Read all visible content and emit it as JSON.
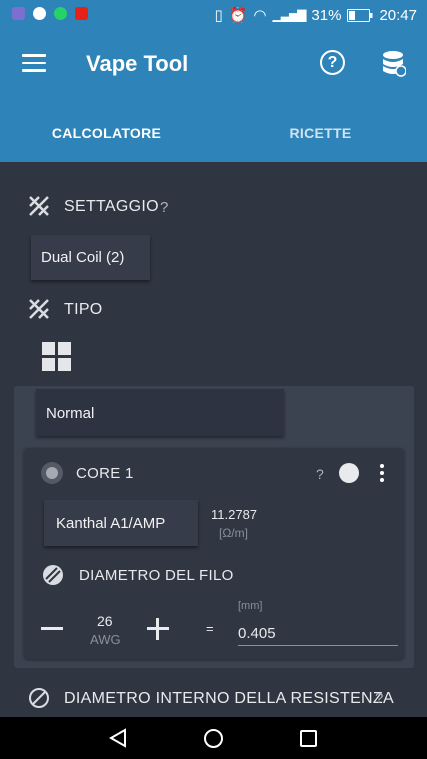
{
  "statusbar": {
    "battery": "31%",
    "time": "20:47"
  },
  "appbar": {
    "title": "Vape Tool",
    "help": "?"
  },
  "tabs": [
    {
      "label": "CALCOLATORE",
      "active": true
    },
    {
      "label": "RICETTE",
      "active": false
    }
  ],
  "settaggio": {
    "label": "SETTAGGIO",
    "help": "?",
    "value": "Dual Coil (2)"
  },
  "tipo": {
    "label": "TIPO",
    "value": "Normal"
  },
  "core": {
    "label": "CORE 1",
    "help": "?",
    "wire": "Kanthal A1/AMP",
    "resistance_per_m": "11.2787",
    "resistance_unit": "[Ω/m]"
  },
  "diametro_filo": {
    "label": "DIAMETRO DEL FILO",
    "gauge": "26",
    "gauge_unit": "AWG",
    "equals": "=",
    "mm_unit": "[mm]",
    "mm_value": "0.405"
  },
  "diametro_interno": {
    "label": "DIAMETRO INTERNO DELLA RESISTENZA",
    "help": "?"
  },
  "colors": {
    "primary": "#2e83b9",
    "background": "#2f3541",
    "panel": "#3c4350"
  }
}
